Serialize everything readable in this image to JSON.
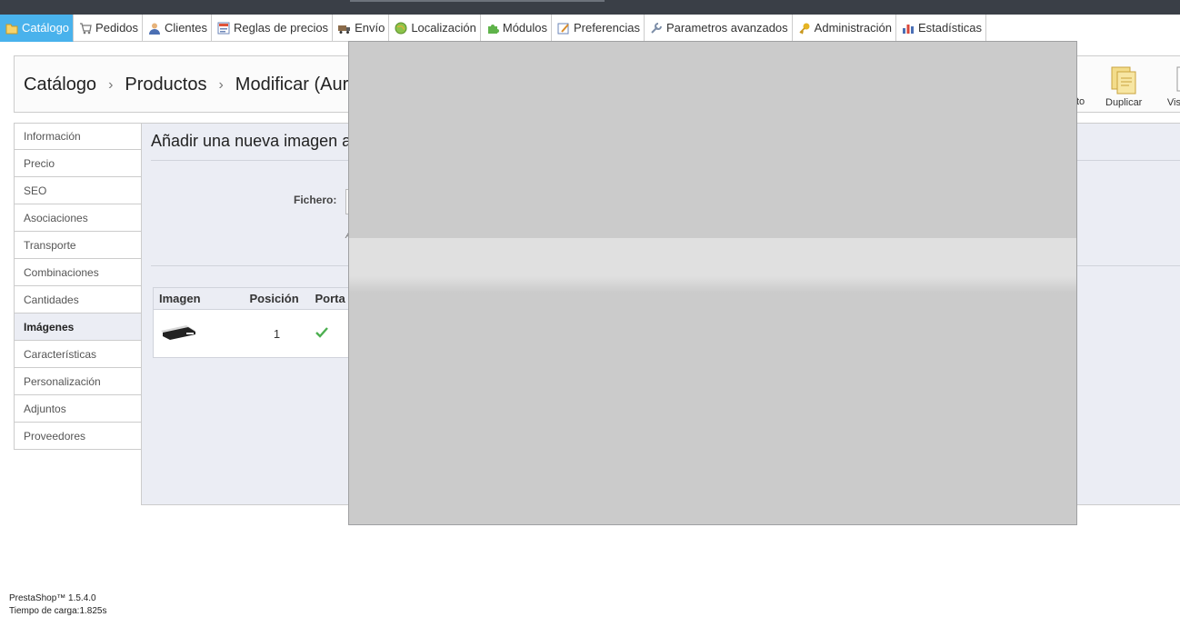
{
  "menu": {
    "items": [
      {
        "label": "Catálogo",
        "icon": "folder-icon",
        "active": true
      },
      {
        "label": "Pedidos",
        "icon": "cart-icon"
      },
      {
        "label": "Clientes",
        "icon": "user-icon"
      },
      {
        "label": "Reglas de precios",
        "icon": "price-tag-icon"
      },
      {
        "label": "Envío",
        "icon": "truck-icon"
      },
      {
        "label": "Localización",
        "icon": "globe-icon"
      },
      {
        "label": "Módulos",
        "icon": "puzzle-icon"
      },
      {
        "label": "Preferencias",
        "icon": "preferences-icon"
      },
      {
        "label": "Parametros avanzados",
        "icon": "wrench-icon"
      },
      {
        "label": "Administración",
        "icon": "key-icon"
      },
      {
        "label": "Estadísticas",
        "icon": "bar-chart-icon"
      }
    ]
  },
  "breadcrumb": {
    "part1": "Catálogo",
    "part2": "Productos",
    "part3": "Modificar (Auri",
    "separator": "›"
  },
  "toolbar": {
    "partial_label": "to",
    "duplicate_label": "Duplicar",
    "preview_label": "Vist"
  },
  "tabs": [
    {
      "label": "Información"
    },
    {
      "label": "Precio"
    },
    {
      "label": "SEO"
    },
    {
      "label": "Asociaciones"
    },
    {
      "label": "Transporte"
    },
    {
      "label": "Combinaciones"
    },
    {
      "label": "Cantidades"
    },
    {
      "label": "Imágenes",
      "active": true
    },
    {
      "label": "Características"
    },
    {
      "label": "Personalización"
    },
    {
      "label": "Adjuntos"
    },
    {
      "label": "Proveedores"
    }
  ],
  "panel": {
    "title": "Añadir una nueva imagen a",
    "file_label": "Fichero:",
    "note_fragment": "A"
  },
  "image_table": {
    "headers": [
      "Imagen",
      "Posición",
      "Porta"
    ],
    "rows": [
      {
        "position": "1",
        "cover_icon": "checkmark-icon"
      }
    ]
  },
  "footer": {
    "version": "PrestaShop™ 1.5.4.0",
    "load_time": "Tiempo de carga:1.825s"
  },
  "colors": {
    "active_menu": "#49b2ec",
    "panel_bg": "#ebedf4",
    "overlay": "#cbcbcb",
    "topbar": "#3a3f47"
  }
}
